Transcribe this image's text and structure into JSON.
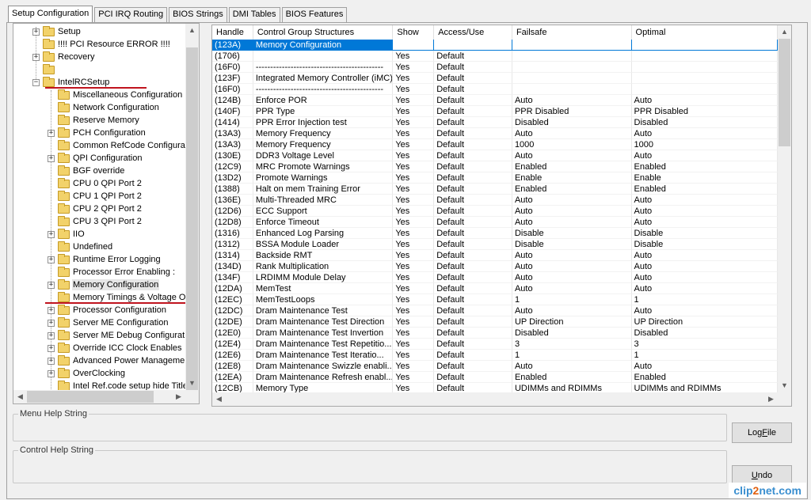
{
  "tabs": [
    {
      "label": "Setup Configuration",
      "active": true
    },
    {
      "label": "PCI IRQ Routing",
      "active": false
    },
    {
      "label": "BIOS Strings",
      "active": false
    },
    {
      "label": "DMI Tables",
      "active": false
    },
    {
      "label": "BIOS Features",
      "active": false
    }
  ],
  "tree": {
    "nodes": [
      {
        "label": "Setup",
        "level": 0,
        "expander": "plus"
      },
      {
        "label": "!!!! PCI Resource ERROR !!!!",
        "level": 0,
        "expander": "none"
      },
      {
        "label": "Recovery",
        "level": 0,
        "expander": "plus"
      },
      {
        "label": "",
        "level": 0,
        "expander": "none"
      },
      {
        "label": "IntelRCSetup",
        "level": 0,
        "expander": "minus"
      },
      {
        "label": "Miscellaneous Configuration",
        "level": 1,
        "expander": "none"
      },
      {
        "label": "Network Configuration",
        "level": 1,
        "expander": "none"
      },
      {
        "label": "Reserve Memory",
        "level": 1,
        "expander": "none"
      },
      {
        "label": "PCH Configuration",
        "level": 1,
        "expander": "plus"
      },
      {
        "label": "Common RefCode Configurati",
        "level": 1,
        "expander": "none"
      },
      {
        "label": "QPI Configuration",
        "level": 1,
        "expander": "plus"
      },
      {
        "label": "BGF override",
        "level": 1,
        "expander": "none"
      },
      {
        "label": "CPU 0 QPI Port 2",
        "level": 1,
        "expander": "none"
      },
      {
        "label": "CPU 1 QPI Port 2",
        "level": 1,
        "expander": "none"
      },
      {
        "label": "CPU 2 QPI Port 2",
        "level": 1,
        "expander": "none"
      },
      {
        "label": "CPU 3 QPI Port 2",
        "level": 1,
        "expander": "none"
      },
      {
        "label": "IIO",
        "level": 1,
        "expander": "plus"
      },
      {
        "label": "Undefined",
        "level": 1,
        "expander": "none"
      },
      {
        "label": "Runtime Error Logging",
        "level": 1,
        "expander": "plus"
      },
      {
        "label": "Processor Error Enabling :",
        "level": 1,
        "expander": "none"
      },
      {
        "label": "Memory Configuration",
        "level": 1,
        "expander": "plus",
        "selected": true
      },
      {
        "label": "Memory Timings & Voltage Ov",
        "level": 1,
        "expander": "none"
      },
      {
        "label": "Processor Configuration",
        "level": 1,
        "expander": "plus"
      },
      {
        "label": "Server ME Configuration",
        "level": 1,
        "expander": "plus"
      },
      {
        "label": "Server ME Debug Configurati",
        "level": 1,
        "expander": "plus"
      },
      {
        "label": "Override ICC Clock Enables",
        "level": 1,
        "expander": "plus"
      },
      {
        "label": "Advanced Power Manageme",
        "level": 1,
        "expander": "plus"
      },
      {
        "label": "OverClocking",
        "level": 1,
        "expander": "plus"
      },
      {
        "label": "Intel Ref.code setup hide Title",
        "level": 1,
        "expander": "none"
      }
    ]
  },
  "grid": {
    "columns": [
      "Handle",
      "Control Group Structures",
      "Show",
      "Access/Use",
      "Failsafe",
      "Optimal"
    ],
    "rows": [
      [
        "(123A)",
        "Memory Configuration",
        "",
        "",
        "",
        ""
      ],
      [
        "(1706)",
        "",
        "Yes",
        "Default",
        "",
        ""
      ],
      [
        "(16F0)",
        "--------------------------------------------",
        "Yes",
        "Default",
        "",
        ""
      ],
      [
        "(123F)",
        "Integrated Memory Controller (iMC)",
        "Yes",
        "Default",
        "",
        ""
      ],
      [
        "(16F0)",
        "--------------------------------------------",
        "Yes",
        "Default",
        "",
        ""
      ],
      [
        "(124B)",
        "Enforce POR",
        "Yes",
        "Default",
        "Auto",
        "Auto"
      ],
      [
        "(140F)",
        "PPR Type",
        "Yes",
        "Default",
        "PPR Disabled",
        "PPR Disabled"
      ],
      [
        "(1414)",
        "PPR Error Injection test",
        "Yes",
        "Default",
        "Disabled",
        "Disabled"
      ],
      [
        "(13A3)",
        "Memory Frequency",
        "Yes",
        "Default",
        "Auto",
        "Auto"
      ],
      [
        "(13A3)",
        "Memory Frequency",
        "Yes",
        "Default",
        "1000",
        "1000"
      ],
      [
        "(130E)",
        "DDR3 Voltage Level",
        "Yes",
        "Default",
        "Auto",
        "Auto"
      ],
      [
        "(12C9)",
        "MRC Promote Warnings",
        "Yes",
        "Default",
        "Enabled",
        "Enabled"
      ],
      [
        "(13D2)",
        "Promote Warnings",
        "Yes",
        "Default",
        "Enable",
        "Enable"
      ],
      [
        "(1388)",
        "Halt on mem Training Error",
        "Yes",
        "Default",
        "Enabled",
        "Enabled"
      ],
      [
        "(136E)",
        "Multi-Threaded MRC",
        "Yes",
        "Default",
        "Auto",
        "Auto"
      ],
      [
        "(12D6)",
        "ECC Support",
        "Yes",
        "Default",
        "Auto",
        "Auto"
      ],
      [
        "(12D8)",
        "Enforce Timeout",
        "Yes",
        "Default",
        "Auto",
        "Auto"
      ],
      [
        "(1316)",
        "Enhanced Log Parsing",
        "Yes",
        "Default",
        "Disable",
        "Disable"
      ],
      [
        "(1312)",
        "BSSA Module Loader",
        "Yes",
        "Default",
        "Disable",
        "Disable"
      ],
      [
        "(1314)",
        "Backside RMT",
        "Yes",
        "Default",
        "Auto",
        "Auto"
      ],
      [
        "(134D)",
        "Rank Multiplication",
        "Yes",
        "Default",
        "Auto",
        "Auto"
      ],
      [
        "(134F)",
        "LRDIMM Module Delay",
        "Yes",
        "Default",
        "Auto",
        "Auto"
      ],
      [
        "(12DA)",
        "MemTest",
        "Yes",
        "Default",
        "Auto",
        "Auto"
      ],
      [
        "(12EC)",
        "MemTestLoops",
        "Yes",
        "Default",
        "1",
        "1"
      ],
      [
        "(12DC)",
        "Dram Maintenance Test",
        "Yes",
        "Default",
        "Auto",
        "Auto"
      ],
      [
        "(12DE)",
        "Dram Maintenance Test Direction",
        "Yes",
        "Default",
        "UP Direction",
        "UP Direction"
      ],
      [
        "(12E0)",
        "Dram Maintenance Test Invertion",
        "Yes",
        "Default",
        "Disabled",
        "Disabled"
      ],
      [
        "(12E4)",
        "Dram Maintenance Test Repetitio...",
        "Yes",
        "Default",
        "3",
        "3"
      ],
      [
        "(12E6)",
        "Dram Maintenance Test Iteratio...",
        "Yes",
        "Default",
        "1",
        "1"
      ],
      [
        "(12E8)",
        "Dram Maintenance Swizzle enabli...",
        "Yes",
        "Default",
        "Auto",
        "Auto"
      ],
      [
        "(12EA)",
        "Dram Maintenance Refresh enabl...",
        "Yes",
        "Default",
        "Enabled",
        "Enabled"
      ],
      [
        "(12CB)",
        "Memory Type",
        "Yes",
        "Default",
        "UDIMMs and RDIMMs",
        "UDIMMs and RDIMMs"
      ]
    ]
  },
  "help": {
    "menu_title": "Menu Help String",
    "control_title": "Control Help String"
  },
  "buttons": {
    "logfile_pre": "Log",
    "logfile_ul": "F",
    "logfile_post": "ile",
    "undo_pre": "",
    "undo_ul": "U",
    "undo_post": "ndo"
  },
  "watermark": {
    "part1": "clip",
    "part2": "2",
    "part3": "net.com"
  }
}
